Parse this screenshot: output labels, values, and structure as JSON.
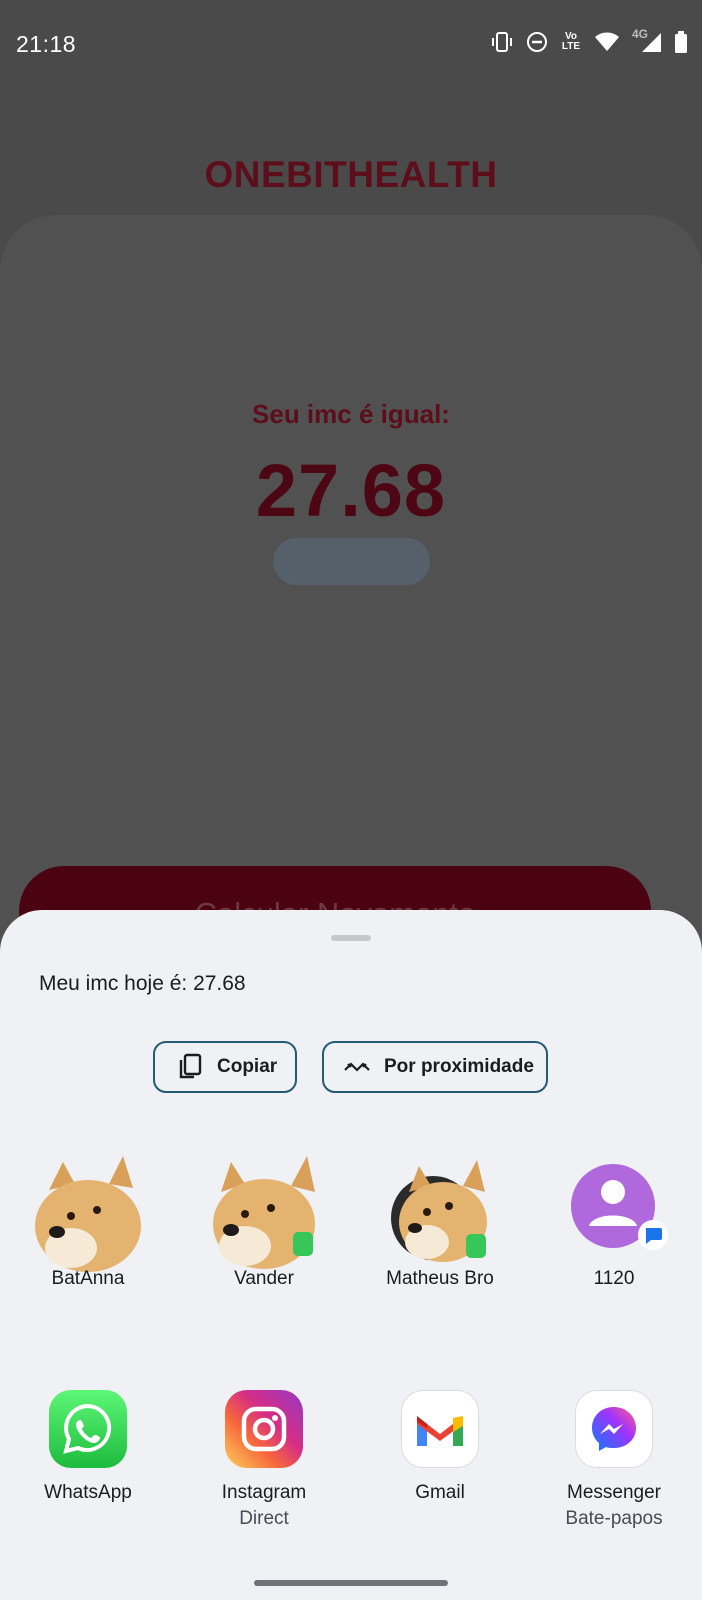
{
  "status_bar": {
    "time": "21:18",
    "icons": [
      "vibrate-icon",
      "do-not-disturb-icon",
      "volte-icon",
      "wifi-icon",
      "4g-signal-icon",
      "battery-icon"
    ],
    "volte_text": "Vo LTE",
    "network_type": "4G"
  },
  "app": {
    "title": "ONEBITHEALTH",
    "imc_label": "Seu imc é igual:",
    "imc_value": "27.68",
    "calc_button_label": "Calcular Novamente",
    "colors": {
      "title": "#5d0e1b",
      "button": "#4b0311"
    }
  },
  "share_sheet": {
    "shared_text": "Meu imc hoje é: 27.68",
    "actions": [
      {
        "label": "Copiar",
        "icon": "copy-icon"
      },
      {
        "label": "Por proximidade",
        "icon": "nearby-share-icon"
      }
    ],
    "contacts": [
      {
        "name": "BatAnna",
        "badge": "none"
      },
      {
        "name": "Vander",
        "badge": "whatsapp"
      },
      {
        "name": "Matheus Bro",
        "badge": "whatsapp"
      },
      {
        "name": "1120",
        "badge": "messages"
      }
    ],
    "apps": [
      {
        "name": "WhatsApp",
        "sub": "",
        "icon": "whatsapp-icon"
      },
      {
        "name": "Instagram",
        "sub": "Direct",
        "icon": "instagram-icon"
      },
      {
        "name": "Gmail",
        "sub": "",
        "icon": "gmail-icon"
      },
      {
        "name": "Messenger",
        "sub": "Bate-papos",
        "icon": "messenger-icon"
      }
    ],
    "accent_color": "#245a73"
  }
}
